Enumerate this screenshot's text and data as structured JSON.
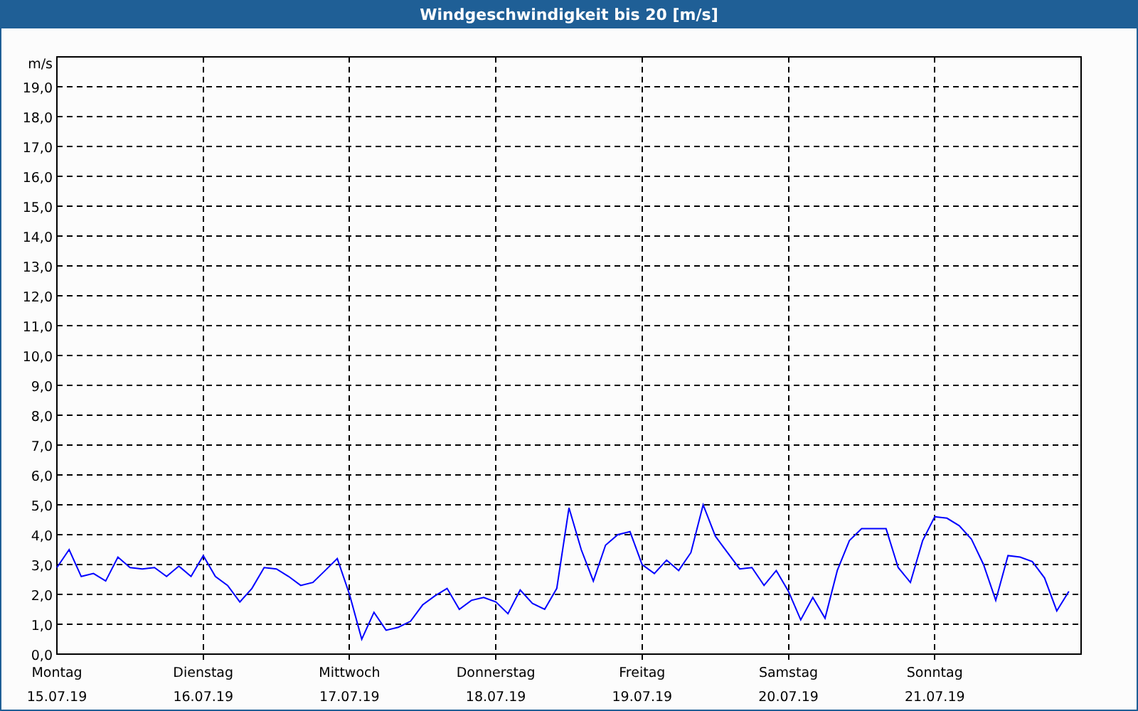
{
  "chart": {
    "chart_data": {
      "type": "line",
      "title": "Windgeschwindigkeit bis 20 [m/s]",
      "ylabel": "m/s",
      "ylim": [
        0,
        20
      ],
      "grid": true,
      "categories": [
        "Montag",
        null,
        null,
        null,
        null,
        null,
        null,
        null,
        null,
        null,
        null,
        null,
        "Dienstag",
        null,
        null,
        null,
        null,
        null,
        null,
        null,
        null,
        null,
        null,
        null,
        "Mittwoch",
        null,
        null,
        null,
        null,
        null,
        null,
        null,
        null,
        null,
        null,
        null,
        "Donnerstag",
        null,
        null,
        null,
        null,
        null,
        null,
        null,
        null,
        null,
        null,
        null,
        "Freitag",
        null,
        null,
        null,
        null,
        null,
        null,
        null,
        null,
        null,
        null,
        null,
        "Samstag",
        null,
        null,
        null,
        null,
        null,
        null,
        null,
        null,
        null,
        null,
        null,
        "Sonntag",
        null,
        null,
        null,
        null,
        null,
        null,
        null,
        null,
        null,
        null,
        null
      ],
      "yticks": [
        {
          "value": 0,
          "label": "0,0"
        },
        {
          "value": 1,
          "label": "1,0"
        },
        {
          "value": 2,
          "label": "2,0"
        },
        {
          "value": 3,
          "label": "3,0"
        },
        {
          "value": 4,
          "label": "4,0"
        },
        {
          "value": 5,
          "label": "5,0"
        },
        {
          "value": 6,
          "label": "6,0"
        },
        {
          "value": 7,
          "label": "7,0"
        },
        {
          "value": 8,
          "label": "8,0"
        },
        {
          "value": 9,
          "label": "9,0"
        },
        {
          "value": 10,
          "label": "10,0"
        },
        {
          "value": 11,
          "label": "11,0"
        },
        {
          "value": 12,
          "label": "12,0"
        },
        {
          "value": 13,
          "label": "13,0"
        },
        {
          "value": 14,
          "label": "14,0"
        },
        {
          "value": 15,
          "label": "15,0"
        },
        {
          "value": 16,
          "label": "16,0"
        },
        {
          "value": 17,
          "label": "17,0"
        },
        {
          "value": 18,
          "label": "18,0"
        },
        {
          "value": 19,
          "label": "19,0"
        }
      ],
      "series": [
        {
          "color": "#0000ff",
          "values": [
            2.9,
            3.5,
            2.6,
            2.7,
            2.45,
            3.25,
            2.9,
            2.85,
            2.9,
            2.6,
            2.95,
            2.6,
            3.3,
            2.6,
            2.3,
            1.75,
            2.2,
            2.9,
            2.85,
            2.6,
            2.3,
            2.4,
            2.8,
            3.2,
            2.0,
            0.5,
            1.4,
            0.8,
            0.9,
            1.1,
            1.65,
            1.95,
            2.2,
            1.5,
            1.8,
            1.9,
            1.75,
            1.35,
            2.15,
            1.7,
            1.5,
            2.2,
            4.9,
            3.5,
            2.45,
            3.65,
            4.0,
            4.1,
            3.0,
            2.7,
            3.15,
            2.8,
            3.4,
            5.0,
            3.95,
            3.4,
            2.85,
            2.9,
            2.3,
            2.8,
            2.1,
            1.15,
            1.9,
            1.2,
            2.8,
            3.8,
            4.2,
            4.2,
            4.2,
            2.9,
            2.4,
            3.8,
            4.6,
            4.55,
            4.3,
            3.85,
            3.0,
            1.8,
            3.3,
            3.25,
            3.1,
            2.55,
            1.45,
            2.1
          ]
        }
      ]
    },
    "tick_dates": [
      "15.07.19",
      "16.07.19",
      "17.07.19",
      "18.07.19",
      "19.07.19",
      "20.07.19",
      "21.07.19"
    ]
  }
}
